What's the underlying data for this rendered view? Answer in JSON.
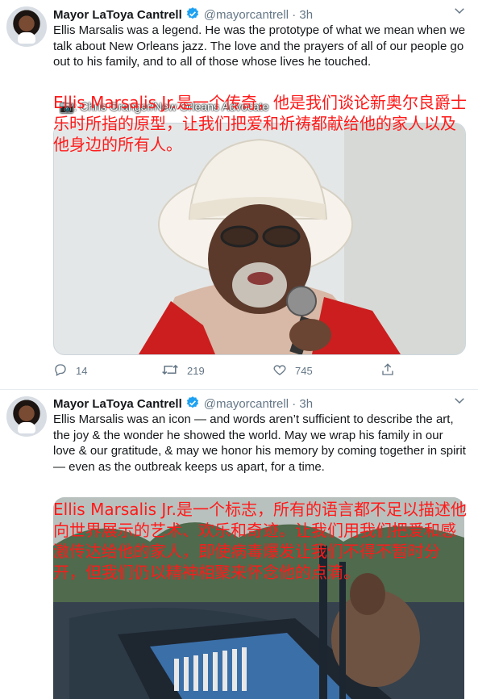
{
  "tweets": [
    {
      "name": "Mayor LaToya Cantrell",
      "handle": "@mayorcantrell",
      "separator": "·",
      "time": "3h",
      "text": "Ellis Marsalis was a legend. He was the prototype of what we mean when we talk about New Orleans jazz. The love and the prayers of all of our people go out to his family, and to all of those whose lives he touched.",
      "overlay_translation": "Ellis Marsalis Jr.是一个传奇，他是我们谈论新奥尔良爵士乐时所指的原型，让我们把爱和祈祷都献给他的家人以及他身边的所有人。",
      "photo_credit": "📷: Chris Granger/New Orleans Advocate",
      "actions": {
        "replies": "14",
        "retweets": "219",
        "likes": "745"
      }
    },
    {
      "name": "Mayor LaToya Cantrell",
      "handle": "@mayorcantrell",
      "separator": "·",
      "time": "3h",
      "text": "Ellis Marsalis was an icon — and words aren’t sufficient to describe the art, the joy & the wonder he showed the world. May we wrap his family in our love & our gratitude, & may we honor his memory by coming together in spirit— even as the outbreak keeps us apart, for a time.",
      "overlay_translation": "Ellis Marsalis Jr.是一个标志，所有的语言都不足以描述他向世界展示的艺术、欢乐和奇迹。让我们用我们把爱和感激传达给他的家人，即使病毒爆发让我们不得不暂时分开，但我们仍以精神相聚来怀念他的点滴。"
    }
  ],
  "colors": {
    "verified": "#1da1f2",
    "muted": "#657786",
    "overlay_text": "#ff1a1a"
  }
}
